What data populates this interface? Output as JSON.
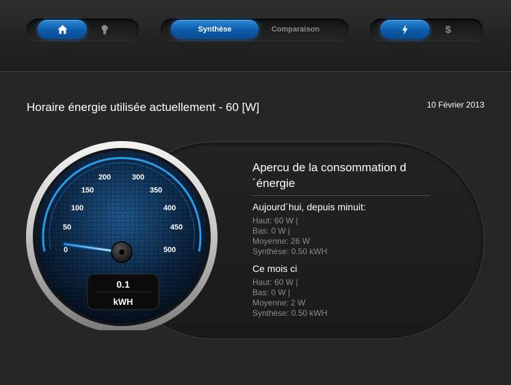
{
  "header": {
    "nav_home_group": {
      "items": [
        {
          "icon": "home-icon",
          "active": true
        },
        {
          "icon": "bulb-icon",
          "active": false
        }
      ]
    },
    "view_tabs": [
      {
        "label": "Synthèse",
        "active": true
      },
      {
        "label": "Comparaison",
        "active": false
      }
    ],
    "unit_toggle": [
      {
        "icon": "lightning-icon",
        "active": true
      },
      {
        "label": "$",
        "active": false
      }
    ]
  },
  "main": {
    "title": "Horaire énergie utilisée actuellement - 60 [W]",
    "date": "10 Février 2013"
  },
  "gauge": {
    "scale_labels": [
      "0",
      "50",
      "100",
      "150",
      "200",
      "300",
      "350",
      "400",
      "450",
      "500"
    ],
    "needle_value": 45,
    "display_value": "0.1",
    "display_unit": "kWH"
  },
  "overview": {
    "title": "Apercu de la consommation d´énergie",
    "today": {
      "heading": "Aujourd´hui, depuis minuit:",
      "high": "Haut: 60 W |",
      "low": "Bas: 0 W |",
      "average": "Moyenne: 26 W",
      "summary": "Synthèse: 0.50 kWH"
    },
    "month": {
      "heading": "Ce mois ci",
      "high": "Haut: 60 W |",
      "low": "Bas: 0 W |",
      "average": "Moyenne: 2 W",
      "summary": "Synthèse: 0.50 kWH"
    }
  },
  "colors": {
    "accent": "#0c5aa8",
    "accent_glow": "#2b8ad8",
    "background": "#262626",
    "muted_text": "#8c8c8c"
  }
}
